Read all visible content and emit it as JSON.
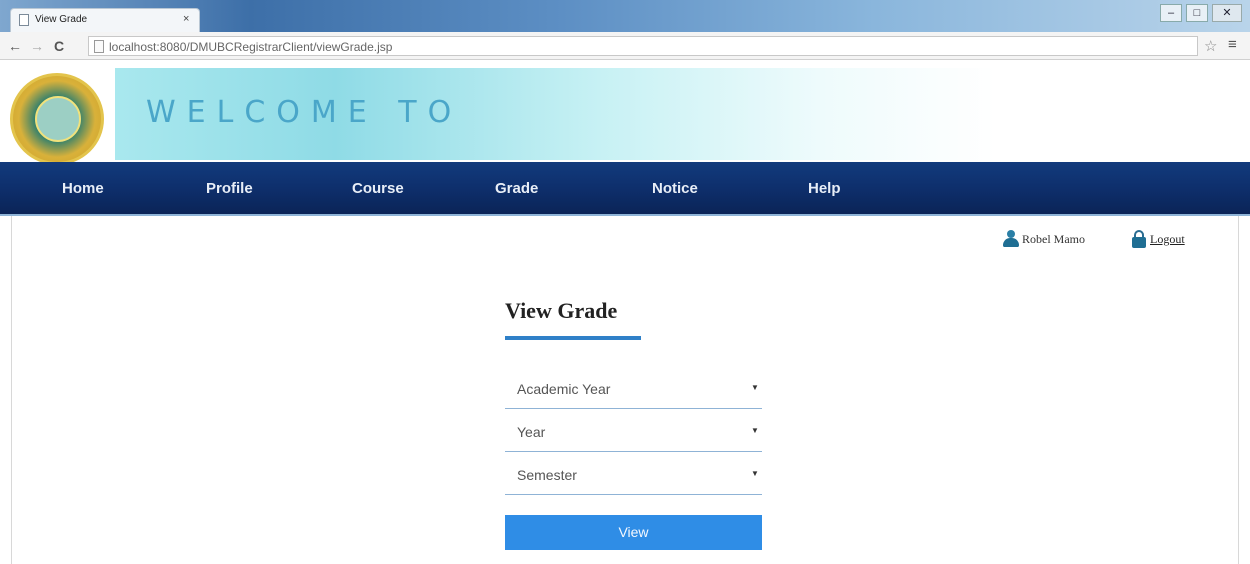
{
  "browser": {
    "tab_title": "View Grade",
    "tab_close": "×",
    "url": "localhost:8080/DMUBCRegistrarClient/viewGrade.jsp",
    "back": "←",
    "forward": "→",
    "reload": "C",
    "star": "☆",
    "menu": "≡",
    "window_min": "–",
    "window_max": "□",
    "window_close": "✕"
  },
  "header": {
    "welcome": "WELCOME TO",
    "logo_icon": "university-seal-icon"
  },
  "nav": {
    "items": [
      {
        "label": "Home"
      },
      {
        "label": "Profile"
      },
      {
        "label": "Course"
      },
      {
        "label": "Grade"
      },
      {
        "label": "Notice"
      },
      {
        "label": "Help"
      }
    ]
  },
  "user": {
    "name": "Robel Mamo",
    "logout": "Logout"
  },
  "main": {
    "title": "View Grade",
    "selects": [
      {
        "label": "Academic Year",
        "arrow": "▼"
      },
      {
        "label": "Year",
        "arrow": "▼"
      },
      {
        "label": "Semester",
        "arrow": "▼"
      }
    ],
    "view_button": "View"
  },
  "colors": {
    "nav_background": "#0e2f6c",
    "accent_blue": "#2f8de6",
    "title_underline": "#2f80c8",
    "welcome_text": "#4aa6c9"
  }
}
